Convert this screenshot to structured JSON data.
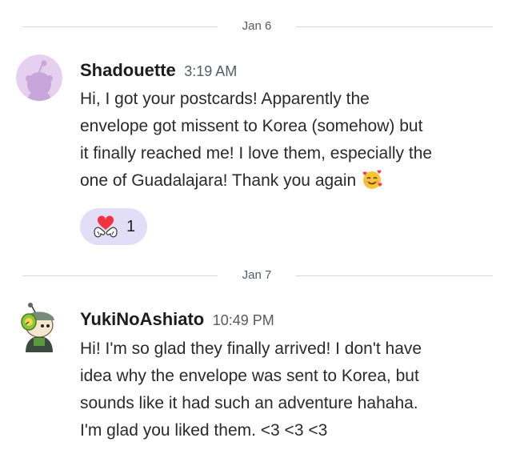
{
  "dividers": [
    {
      "label": "Jan 6"
    },
    {
      "label": "Jan 7"
    }
  ],
  "messages": [
    {
      "author": "Shadouette",
      "time": "3:19 AM",
      "lines": [
        "Hi, I got your postcards! Apparently the",
        "envelope got missent to Korea (somehow) but",
        "it finally reached me! I love them, especially the",
        "one of Guadalajara! Thank you again"
      ],
      "inline_emoji": "smiling-face-with-hearts-icon",
      "reaction": {
        "icon": "heart-hands-icon",
        "count": "1"
      }
    },
    {
      "author": "YukiNoAshiato",
      "time": "10:49 PM",
      "lines": [
        "Hi! I'm so glad they finally arrived! I don't have",
        "idea why the envelope was sent to Korea, but",
        "sounds like it had such an adventure hahaha.",
        "I'm glad you liked them. <3 <3 <3"
      ]
    }
  ],
  "colors": {
    "reaction_bg": "#e3def7",
    "avatar1_bg": "#e6d0ef",
    "avatar1_fg": "#c8a6db",
    "divider": "#d6d6d6"
  }
}
